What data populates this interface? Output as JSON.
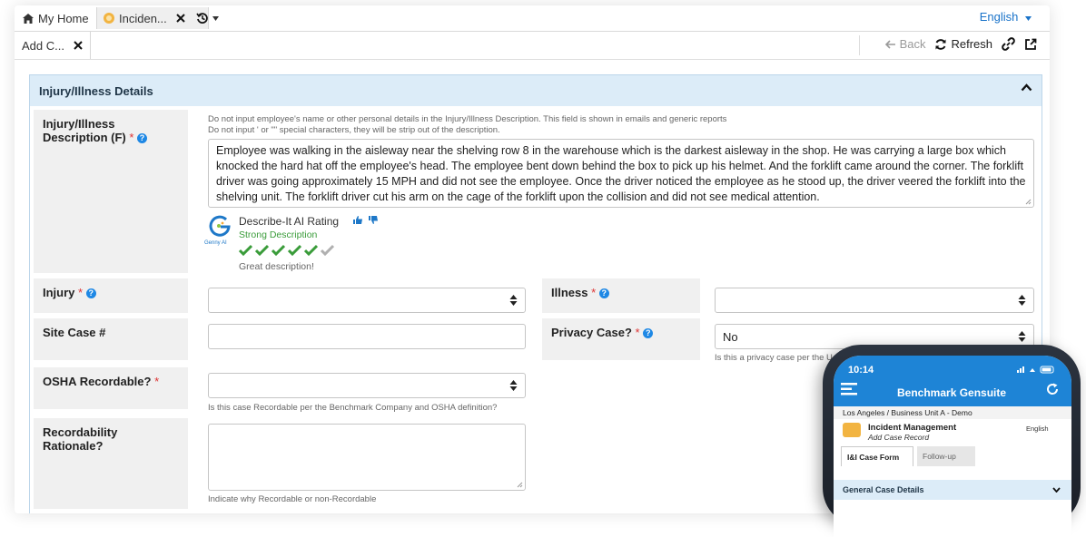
{
  "tabs": {
    "home": "My Home",
    "incident": "Inciden...",
    "language": "English"
  },
  "toolbar": {
    "subtab": "Add C...",
    "back": "Back",
    "refresh": "Refresh"
  },
  "panel": {
    "title": "Injury/Illness Details"
  },
  "description": {
    "label": "Injury/Illness Description (F)",
    "hint1": "Do not input employee's name or other personal details in the Injury/Illness Description. This field is shown in emails and generic reports",
    "hint2": "Do not input ' or \"\" special characters, they will be strip out of the description.",
    "value": "Employee was walking in the aisleway near the shelving row 8 in the warehouse which is the darkest aisleway in the shop. He was carrying a large box which knocked the hard hat off the employee's head. The employee bent down behind the box to pick up his helmet. And the forklift came around the corner. The forklift driver was going approximately 15 MPH and did not see the employee. Once the driver noticed the employee as he stood up, the driver veered the forklift into the shelving unit. The forklift driver cut his arm on the cage of the forklift upon the collision and did not see medical attention."
  },
  "rating": {
    "title": "Describe-It AI Rating",
    "status": "Strong Description",
    "logo_text": "Genny AI",
    "score": 5,
    "max": 6,
    "comment": "Great description!",
    "check_color": "#3a9c3a"
  },
  "fields": {
    "injury_label": "Injury",
    "illness_label": "Illness",
    "site_case_label": "Site Case #",
    "privacy_label": "Privacy Case?",
    "privacy_value": "No",
    "privacy_hint": "Is this a privacy case per the U.S.",
    "osha_label": "OSHA Recordable?",
    "osha_hint": "Is this case Recordable per the Benchmark Company and OSHA definition?",
    "rationale_label": "Recordability Rationale?",
    "rationale_hint": "Indicate why Recordable or non-Recordable"
  },
  "phone": {
    "time": "10:14",
    "app_title": "Benchmark Gensuite",
    "location": "Los Angeles / Business Unit A - Demo",
    "module": "Incident Management",
    "subtitle": "Add Case Record",
    "language": "English",
    "tab1": "I&I Case Form",
    "tab2": "Follow-up",
    "section": "General Case Details"
  },
  "colors": {
    "accent": "#1e88e5",
    "panel_header": "#dcecf8",
    "required": "#d33333"
  }
}
